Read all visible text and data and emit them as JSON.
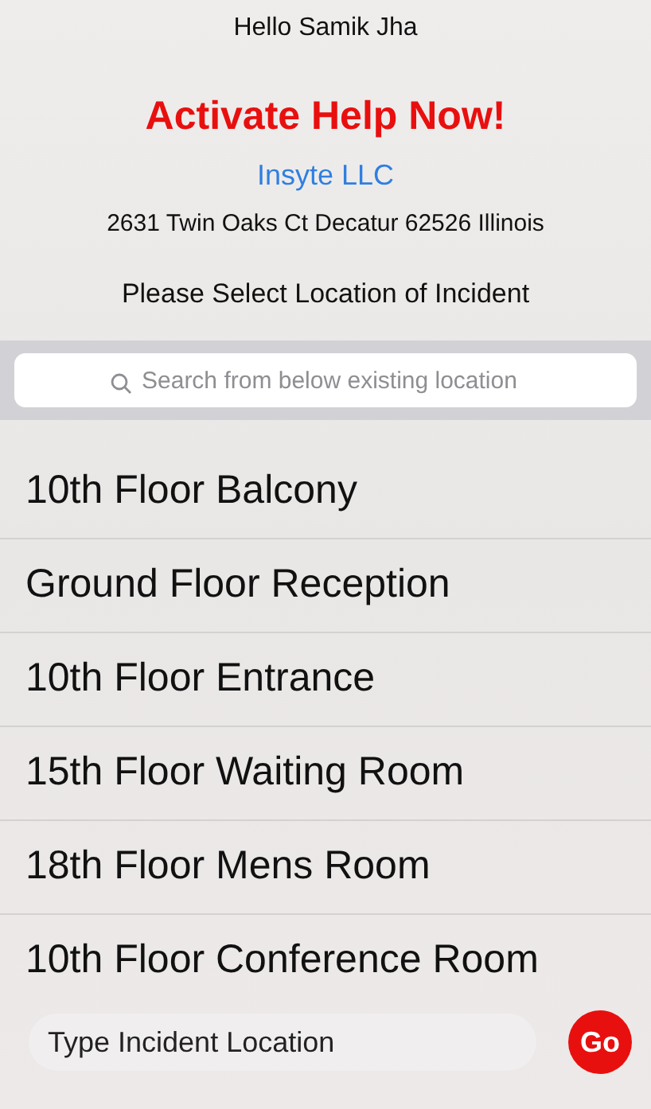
{
  "greeting": "Hello Samik Jha",
  "title": "Activate Help Now!",
  "company": "Insyte LLC",
  "address": "2631 Twin Oaks Ct Decatur 62526 Illinois",
  "prompt": "Please Select Location of Incident",
  "search": {
    "placeholder": "Search from below existing location"
  },
  "locations": [
    {
      "label": "10th Floor Balcony"
    },
    {
      "label": "Ground Floor Reception"
    },
    {
      "label": "10th Floor Entrance"
    },
    {
      "label": "15th Floor Waiting Room"
    },
    {
      "label": "18th Floor Mens Room"
    },
    {
      "label": "10th Floor Conference Room"
    }
  ],
  "location_input": {
    "placeholder": "Type Incident Location"
  },
  "go_button": "Go"
}
